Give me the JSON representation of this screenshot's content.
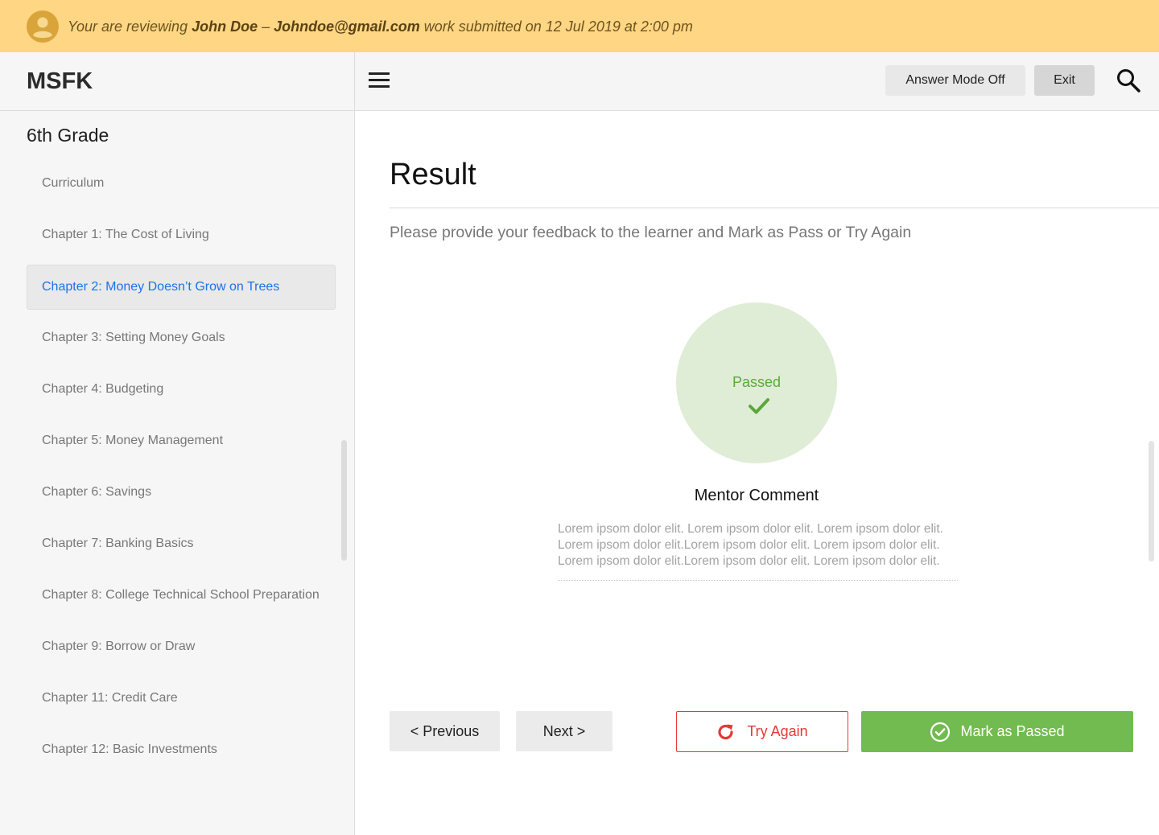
{
  "banner": {
    "prefix": "Your are reviewing ",
    "name": "John Doe",
    "separator": " – ",
    "email": "Johndoe@gmail.com",
    "suffix": " work submitted on 12 Jul 2019 at 2:00 pm",
    "icon": "user-avatar-icon"
  },
  "sidebar": {
    "brand": "MSFK",
    "grade": "6th Grade",
    "items": [
      {
        "label": "Curriculum",
        "active": false
      },
      {
        "label": "Chapter 1: The Cost of Living",
        "active": false
      },
      {
        "label": "Chapter 2: Money Doesn’t Grow on Trees",
        "active": true
      },
      {
        "label": "Chapter 3: Setting Money Goals",
        "active": false
      },
      {
        "label": "Chapter 4: Budgeting",
        "active": false
      },
      {
        "label": "Chapter 5: Money Management",
        "active": false
      },
      {
        "label": "Chapter 6: Savings",
        "active": false
      },
      {
        "label": "Chapter 7: Banking Basics",
        "active": false
      },
      {
        "label": "Chapter 8: College Technical School Preparation",
        "active": false
      },
      {
        "label": "Chapter 9: Borrow or Draw",
        "active": false
      },
      {
        "label": "Chapter 11: Credit Care",
        "active": false
      },
      {
        "label": "Chapter 12: Basic Investments",
        "active": false
      }
    ]
  },
  "topbar": {
    "menu_icon": "hamburger-menu-icon",
    "answer_mode_label": "Answer Mode Off",
    "exit_label": "Exit",
    "search_icon": "search-icon"
  },
  "main": {
    "title": "Result",
    "subtitle": "Please provide your feedback to the learner and Mark as Pass or Try Again",
    "status": "Passed",
    "mentor_heading": "Mentor Comment",
    "comment_lines": [
      "Lorem ipsom dolor elit. Lorem ipsom dolor elit. Lorem ipsom dolor elit.",
      "Lorem ipsom dolor elit.Lorem ipsom dolor elit. Lorem ipsom dolor elit.",
      "Lorem ipsom dolor elit.Lorem ipsom dolor elit. Lorem ipsom dolor elit."
    ]
  },
  "actions": {
    "previous": "< Previous",
    "next": "Next >",
    "try_again": "Try Again",
    "mark_passed": "Mark as Passed"
  },
  "colors": {
    "banner_bg": "#ffd683",
    "accent_blue": "#1a73e8",
    "pass_green": "#72bb50",
    "fail_red": "#e53935"
  }
}
